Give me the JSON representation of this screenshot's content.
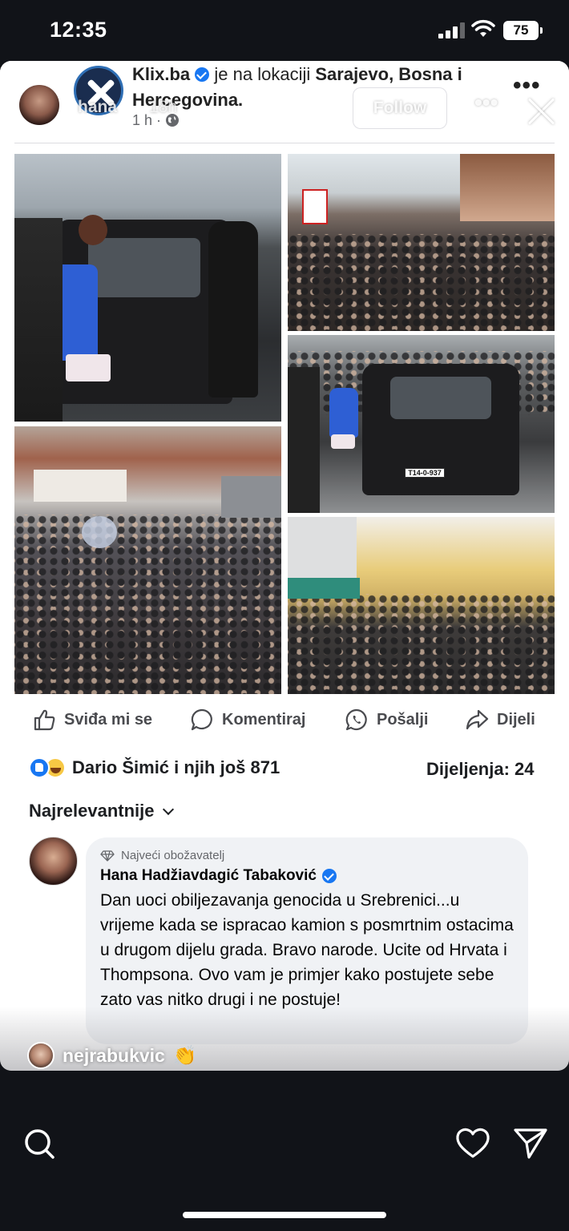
{
  "status_bar": {
    "time": "12:35",
    "battery": "75"
  },
  "post_header": {
    "page_name": "Klix.ba",
    "location_prefix": "je na lokaciji",
    "location_line1": "Sarajevo, Bosna i",
    "location_line2": "Hercegovina.",
    "time": "1 h ·"
  },
  "story": {
    "username": "hana",
    "age": "18h",
    "follow_label": "Follow",
    "more_icon": "more-dots-icon",
    "close_icon": "close-icon"
  },
  "photos": {
    "plate_1": "T14-0-937"
  },
  "actions": {
    "like": "Sviđa mi se",
    "comment": "Komentiraj",
    "send": "Pošalji",
    "share": "Dijeli"
  },
  "engagement": {
    "reactions_text": "Dario Šimić i njih još 871",
    "shares_text": "Dijeljenja: 24"
  },
  "sort": {
    "label": "Najrelevantnije"
  },
  "comment": {
    "badge": "Najveći obožavatelj",
    "author": "Hana Hadžiavdagić Tabaković",
    "text": "Dan uoci obiljezavanja genocida u Srebrenici...u vrijeme kada se ispracao kamion s posmrtnim ostacima u drugom dijelu grada. Bravo narode. Ucite od Hrvata i Thompsona. Ovo vam je primjer kako postujete sebe zato vas nitko drugi i ne postuje!"
  },
  "mention": {
    "username": "nejrabukvic",
    "emoji": "👏"
  },
  "colors": {
    "facebook_blue": "#1877f2",
    "background": "#111318"
  }
}
